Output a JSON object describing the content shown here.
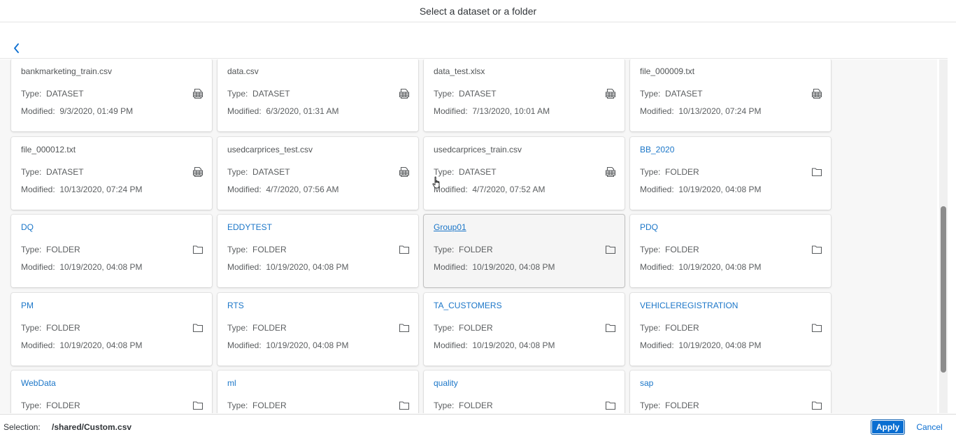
{
  "dialog": {
    "title": "Select a dataset or a folder"
  },
  "labels": {
    "type_prefix": "Type:",
    "modified_prefix": "Modified:"
  },
  "items": [
    {
      "name": "bankmarketing_train.csv",
      "type": "DATASET",
      "modified": "9/3/2020, 01:49 PM",
      "icon": "dataset-icon"
    },
    {
      "name": "data.csv",
      "type": "DATASET",
      "modified": "6/3/2020, 01:31 AM",
      "icon": "dataset-icon"
    },
    {
      "name": "data_test.xlsx",
      "type": "DATASET",
      "modified": "7/13/2020, 10:01 AM",
      "icon": "dataset-icon"
    },
    {
      "name": "file_000009.txt",
      "type": "DATASET",
      "modified": "10/13/2020, 07:24 PM",
      "icon": "dataset-icon"
    },
    {
      "name": "file_000012.txt",
      "type": "DATASET",
      "modified": "10/13/2020, 07:24 PM",
      "icon": "dataset-icon"
    },
    {
      "name": "usedcarprices_test.csv",
      "type": "DATASET",
      "modified": "4/7/2020, 07:56 AM",
      "icon": "dataset-icon"
    },
    {
      "name": "usedcarprices_train.csv",
      "type": "DATASET",
      "modified": "4/7/2020, 07:52 AM",
      "icon": "dataset-icon"
    },
    {
      "name": "BB_2020",
      "type": "FOLDER",
      "modified": "10/19/2020, 04:08 PM",
      "icon": "folder-icon"
    },
    {
      "name": "DQ",
      "type": "FOLDER",
      "modified": "10/19/2020, 04:08 PM",
      "icon": "folder-icon"
    },
    {
      "name": "EDDYTEST",
      "type": "FOLDER",
      "modified": "10/19/2020, 04:08 PM",
      "icon": "folder-icon"
    },
    {
      "name": "Group01",
      "type": "FOLDER",
      "modified": "10/19/2020, 04:08 PM",
      "icon": "folder-icon",
      "hovered": true
    },
    {
      "name": "PDQ",
      "type": "FOLDER",
      "modified": "10/19/2020, 04:08 PM",
      "icon": "folder-icon"
    },
    {
      "name": "PM",
      "type": "FOLDER",
      "modified": "10/19/2020, 04:08 PM",
      "icon": "folder-icon"
    },
    {
      "name": "RTS",
      "type": "FOLDER",
      "modified": "10/19/2020, 04:08 PM",
      "icon": "folder-icon"
    },
    {
      "name": "TA_CUSTOMERS",
      "type": "FOLDER",
      "modified": "10/19/2020, 04:08 PM",
      "icon": "folder-icon"
    },
    {
      "name": "VEHICLEREGISTRATION",
      "type": "FOLDER",
      "modified": "10/19/2020, 04:08 PM",
      "icon": "folder-icon"
    },
    {
      "name": "WebData",
      "type": "FOLDER",
      "modified": "",
      "icon": "folder-icon"
    },
    {
      "name": "ml",
      "type": "FOLDER",
      "modified": "",
      "icon": "folder-icon"
    },
    {
      "name": "quality",
      "type": "FOLDER",
      "modified": "",
      "icon": "folder-icon"
    },
    {
      "name": "sap",
      "type": "FOLDER",
      "modified": "",
      "icon": "folder-icon"
    }
  ],
  "footer": {
    "selection_label": "Selection:",
    "selection_value": "/shared/Custom.csv",
    "apply_label": "Apply",
    "cancel_label": "Cancel"
  },
  "colors": {
    "link": "#1b76c8",
    "accent": "#0a6ed1"
  }
}
